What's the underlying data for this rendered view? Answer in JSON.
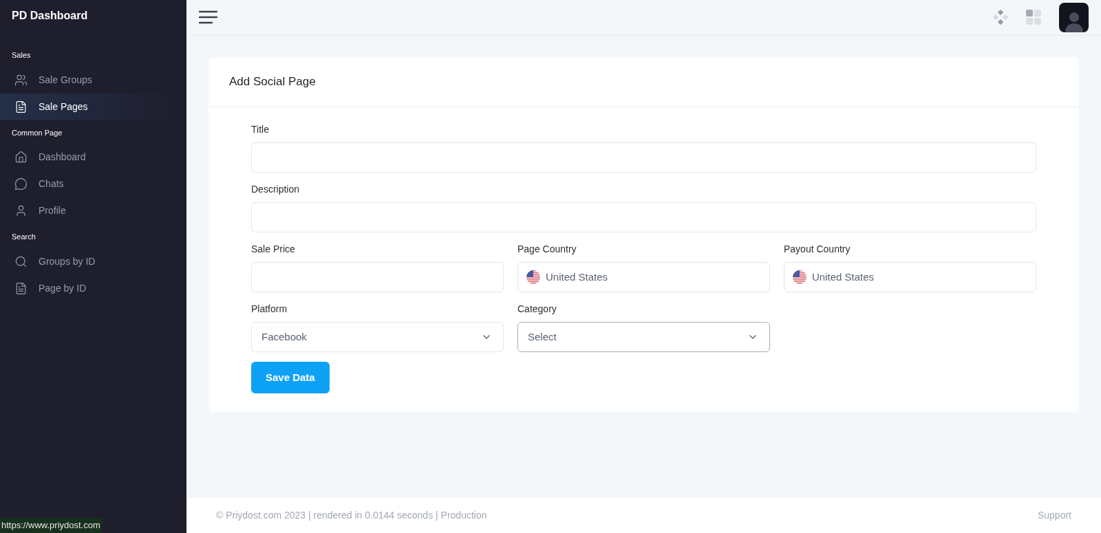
{
  "brand": "PD Dashboard",
  "sidebar": {
    "sections": [
      {
        "title": "Sales",
        "items": [
          {
            "label": "Sale Groups",
            "kind": "users",
            "selected": false
          },
          {
            "label": "Sale Pages",
            "kind": "file",
            "selected": true
          }
        ]
      },
      {
        "title": "Common Page",
        "items": [
          {
            "label": "Dashboard",
            "kind": "home",
            "selected": false
          },
          {
            "label": "Chats",
            "kind": "chat",
            "selected": false
          },
          {
            "label": "Profile",
            "kind": "user",
            "selected": false
          }
        ]
      },
      {
        "title": "Search",
        "items": [
          {
            "label": "Groups by ID",
            "kind": "search",
            "selected": false
          },
          {
            "label": "Page by ID",
            "kind": "file",
            "selected": false
          }
        ]
      }
    ]
  },
  "form": {
    "title": "Add Social Page",
    "rows": [
      [
        {
          "kind": "text",
          "label": "Title",
          "focused": false
        }
      ],
      [
        {
          "kind": "text",
          "label": "Description",
          "focused": false
        }
      ],
      [
        {
          "kind": "text",
          "label": "Sale Price",
          "focused": false
        },
        {
          "kind": "country",
          "label": "Page Country",
          "value": "United States",
          "focused": false
        },
        {
          "kind": "country",
          "label": "Payout Country",
          "value": "United States",
          "focused": false
        }
      ],
      [
        {
          "kind": "select",
          "label": "Platform",
          "value": "Facebook",
          "focused": false
        },
        {
          "kind": "select",
          "label": "Category",
          "value": "Select",
          "focused": true
        }
      ]
    ],
    "submit": "Save Data"
  },
  "footer": {
    "text": "© Priydost.com 2023 | rendered in 0.0144 seconds | Production",
    "link": "Support"
  },
  "status_url": "https://www.priydost.com"
}
